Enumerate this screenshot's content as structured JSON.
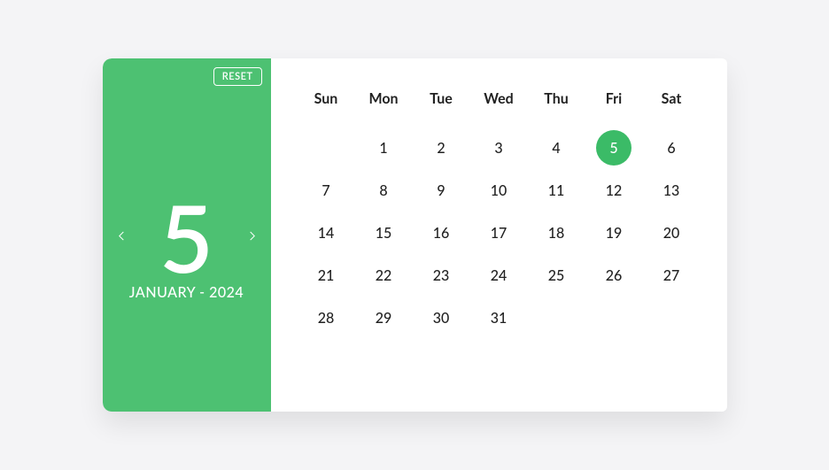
{
  "accent_color": "#4dc172",
  "selected_accent": "#3bbb67",
  "reset_label": "RESET",
  "selected_day": 5,
  "big_date": "5",
  "month_year": "JANUARY - 2024",
  "weekday_headers": [
    "Sun",
    "Mon",
    "Tue",
    "Wed",
    "Thu",
    "Fri",
    "Sat"
  ],
  "weeks": [
    [
      "",
      "1",
      "2",
      "3",
      "4",
      "5",
      "6"
    ],
    [
      "7",
      "8",
      "9",
      "10",
      "11",
      "12",
      "13"
    ],
    [
      "14",
      "15",
      "16",
      "17",
      "18",
      "19",
      "20"
    ],
    [
      "21",
      "22",
      "23",
      "24",
      "25",
      "26",
      "27"
    ],
    [
      "28",
      "29",
      "30",
      "31",
      "",
      "",
      ""
    ]
  ]
}
